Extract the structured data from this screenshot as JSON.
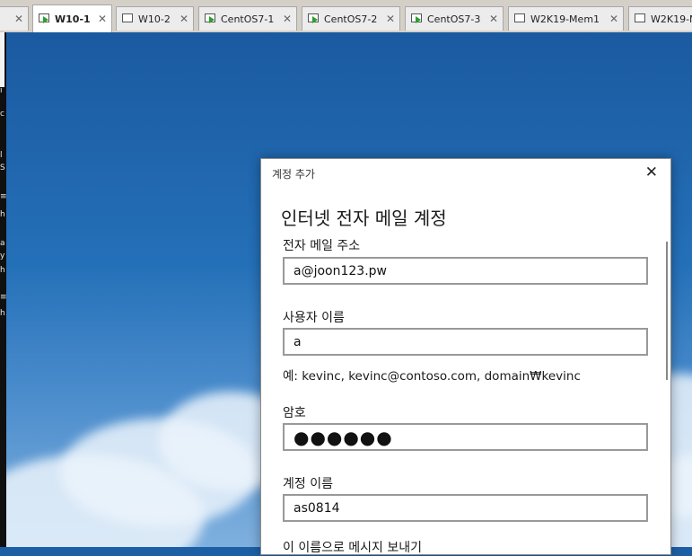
{
  "vm_tabs": [
    {
      "label": "",
      "active": false,
      "running": false
    },
    {
      "label": "W10-1",
      "active": true,
      "running": true
    },
    {
      "label": "W10-2",
      "active": false,
      "running": false
    },
    {
      "label": "CentOS7-1",
      "active": false,
      "running": true
    },
    {
      "label": "CentOS7-2",
      "active": false,
      "running": true
    },
    {
      "label": "CentOS7-3",
      "active": false,
      "running": true
    },
    {
      "label": "W2K19-Mem1",
      "active": false,
      "running": false
    },
    {
      "label": "W2K19-M",
      "active": false,
      "running": false
    }
  ],
  "tab_close_glyph": "✕",
  "left_fragments": [
    "i",
    "c",
    "l",
    "S",
    "≡",
    "h",
    "a",
    "y",
    "h",
    "≡",
    "h"
  ],
  "dialog": {
    "title": "계정 추가",
    "close_glyph": "✕",
    "heading": "인터넷 전자 메일 계정",
    "email_label": "전자 메일 주소",
    "email_value": "a@joon123.pw",
    "username_label": "사용자 이름",
    "username_value": "a",
    "username_hint": "예: kevinc, kevinc@contoso.com, domain₩kevinc",
    "password_label": "암호",
    "password_value": "●●●●●●",
    "account_name_label": "계정 이름",
    "account_name_value": "as0814",
    "send_as_label": "이 이름으로 메시지 보내기"
  },
  "colors": {
    "desktop_blue": "#1d5fa5",
    "running_green": "#2aa02a"
  }
}
